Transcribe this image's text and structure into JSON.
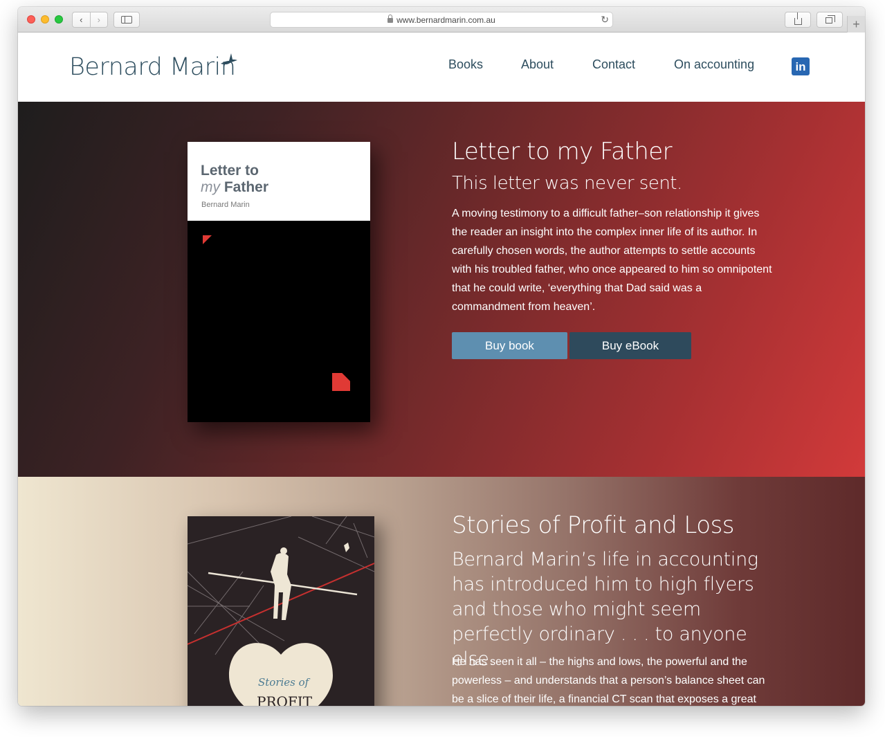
{
  "browser": {
    "url": "www.bernardmarin.com.au",
    "reload_glyph": "↻",
    "back_glyph": "‹",
    "forward_glyph": "›",
    "new_tab_glyph": "+"
  },
  "header": {
    "logo_text": "Bernard Marin",
    "nav": [
      {
        "label": "Books"
      },
      {
        "label": "About"
      },
      {
        "label": "Contact"
      },
      {
        "label": "On accounting"
      }
    ],
    "linkedin_text": "in",
    "linkedin_color": "#2867b2",
    "brand_color": "#2d4d5e"
  },
  "book1": {
    "cover_title_line1": "Letter to",
    "cover_title_my": "my",
    "cover_title_father": "Father",
    "cover_author": "Bernard Marin",
    "title": "Letter to my Father",
    "subtitle": "This letter was never sent.",
    "description": "A moving testimony to a difficult father–son relationship it gives the reader an insight into the complex inner life of its author. In carefully chosen words, the author attempts to settle accounts with his troubled father, who once appeared to him so omnipotent that he could write, ‘everything that Dad said was a commandment from heaven’.",
    "buy_book_label": "Buy book",
    "buy_ebook_label": "Buy eBook",
    "buy_book_color": "#5e8fb0",
    "buy_ebook_color": "#2e4a5c",
    "accent_color": "#e03a35"
  },
  "book2": {
    "cover_text_line1": "Stories of",
    "cover_text_line2": "PROFIT",
    "title": "Stories of Profit and Loss",
    "lead": "Bernard Marin’s life in accounting has introduced him to high flyers and those who might seem perfectly ordinary . . . to anyone else.",
    "description": "He has seen it all – the highs and lows, the powerful and the powerless – and understands that a person’s balance sheet can be a slice of their life, a financial CT scan that exposes a great deal."
  }
}
